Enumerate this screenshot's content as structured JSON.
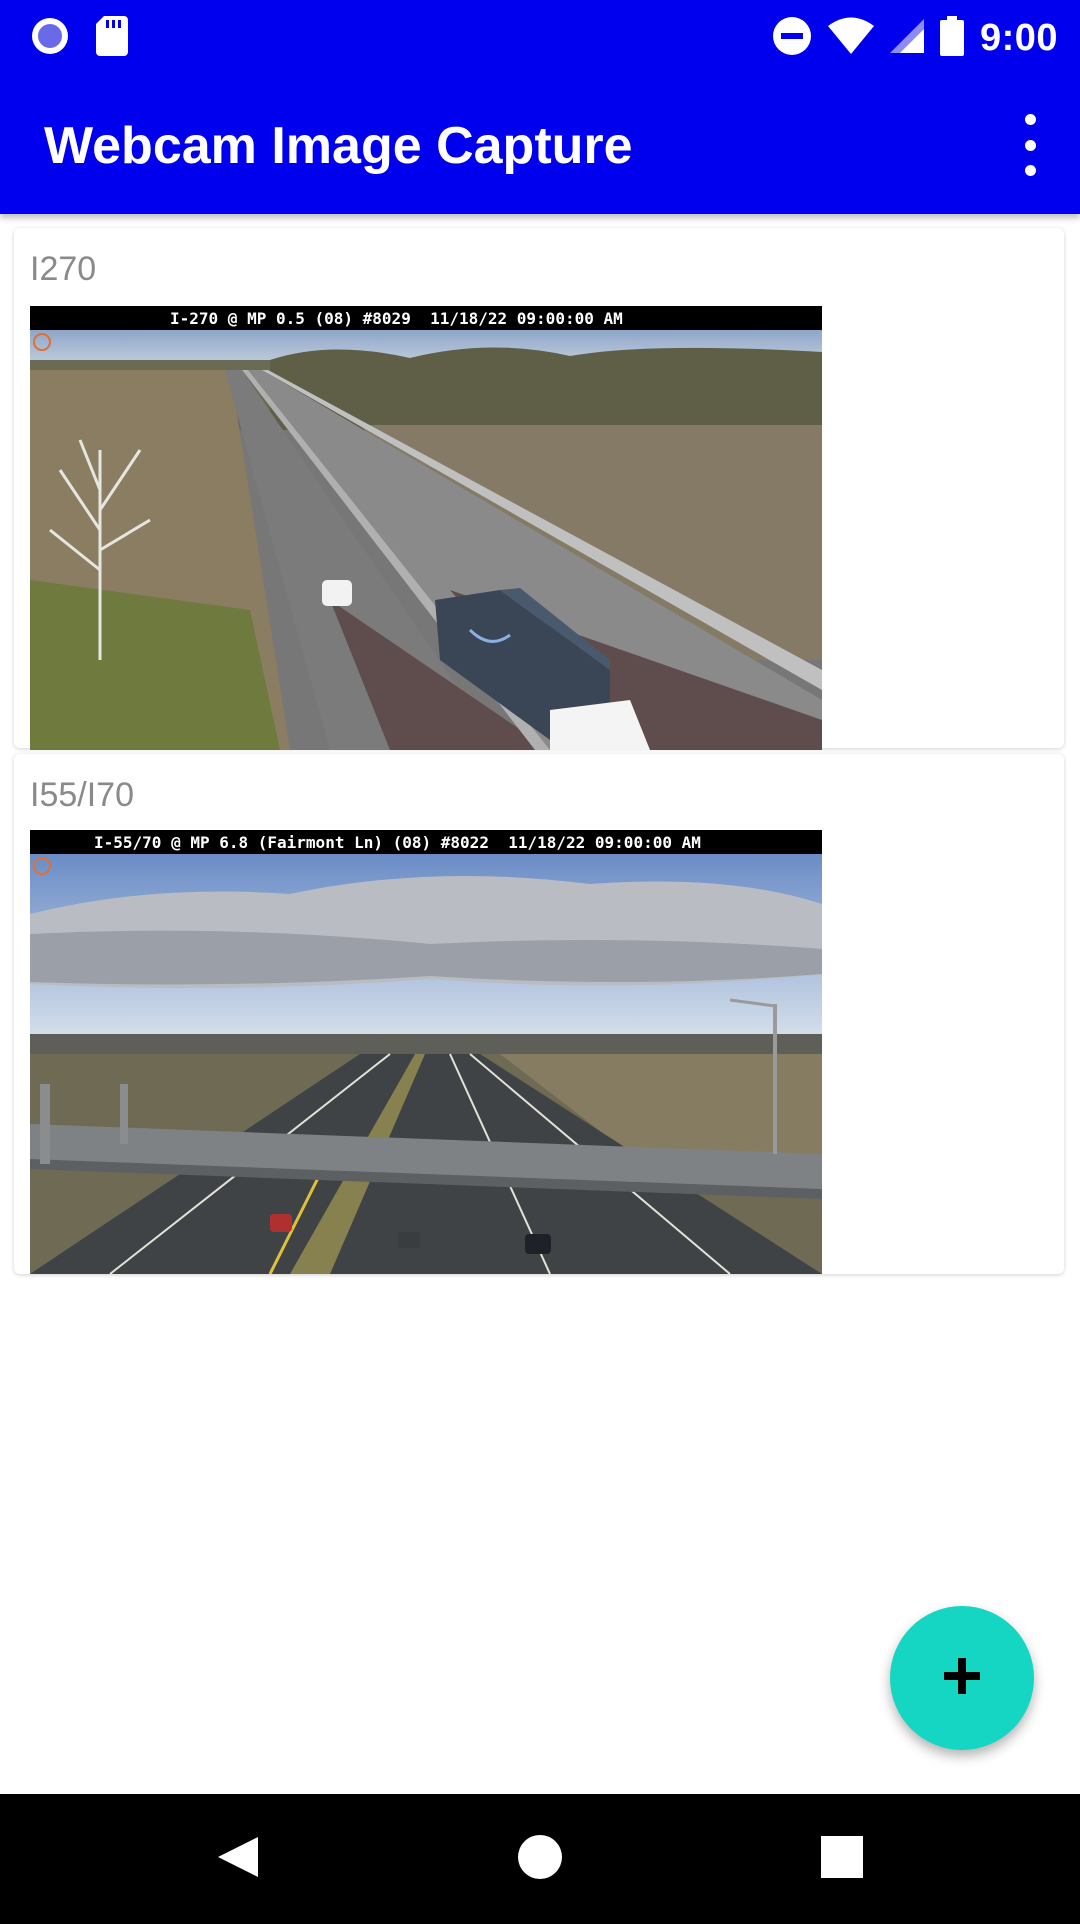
{
  "status_bar": {
    "time": "9:00",
    "left_icons": [
      "circle-notification-icon",
      "sd-card-icon"
    ],
    "right_icons": [
      "do-not-disturb-icon",
      "wifi-icon",
      "cell-signal-icon",
      "battery-icon"
    ]
  },
  "app_bar": {
    "title": "Webcam Image Capture",
    "overflow_icon": "more-vert-icon"
  },
  "webcams": [
    {
      "title": "I270",
      "caption": "I-270 @ MP 0.5 (08) #8029  11/18/22 09:00:00 AM"
    },
    {
      "title": "I55/I70",
      "caption": "I-55/70 @ MP 6.8 (Fairmont Ln) (08) #8022  11/18/22 09:00:00 AM"
    }
  ],
  "fab": {
    "icon": "add-icon"
  },
  "nav_bar": {
    "icons": [
      "back-icon",
      "home-icon",
      "recents-icon"
    ]
  },
  "colors": {
    "primary": "#0000ee",
    "accent": "#14d6c3",
    "title_gray": "#8a8a8a"
  }
}
